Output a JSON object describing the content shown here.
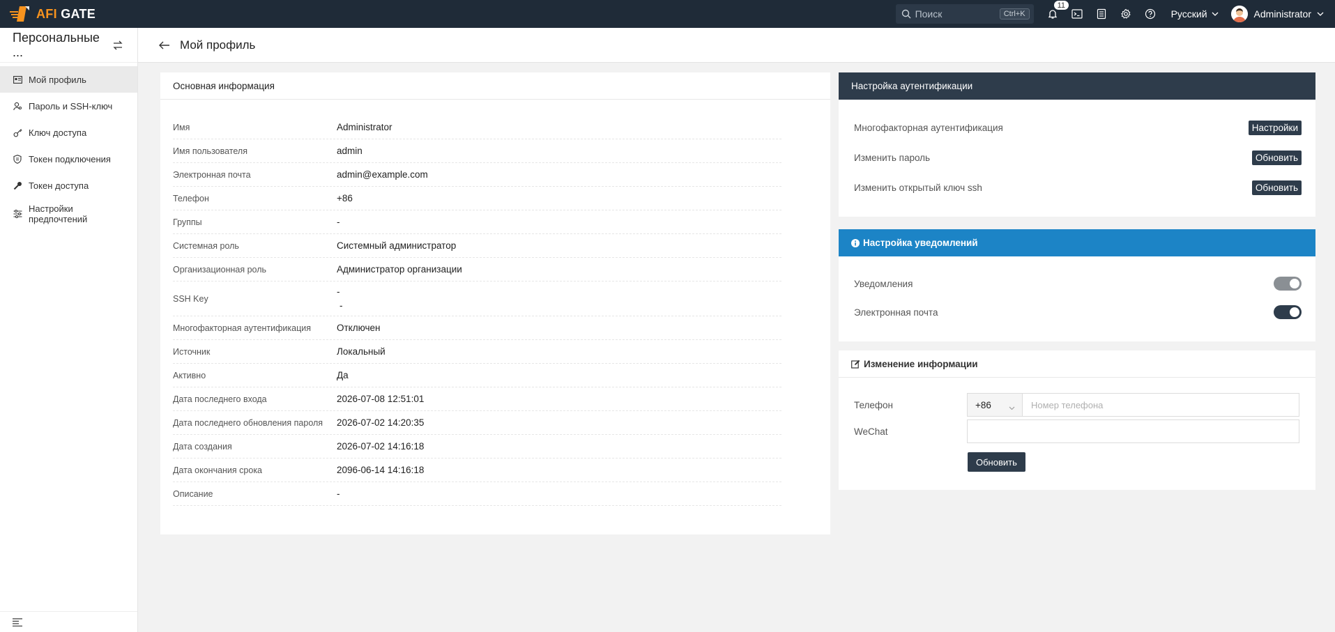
{
  "app": {
    "logo_prefix": "AFI",
    "logo_suffix": "GATE"
  },
  "topbar": {
    "search_placeholder": "Поиск",
    "search_shortcut": "Ctrl+K",
    "notifications_count": "11",
    "language": "Русский",
    "user_name": "Administrator"
  },
  "sidebar": {
    "title": "Персональные ...",
    "items": [
      {
        "label": "Мой профиль",
        "icon": "profile-card-icon",
        "active": true
      },
      {
        "label": "Пароль и SSH-ключ",
        "icon": "user-key-icon"
      },
      {
        "label": "Ключ доступа",
        "icon": "key-icon"
      },
      {
        "label": "Токен подключения",
        "icon": "shield-token-icon"
      },
      {
        "label": "Токен доступа",
        "icon": "wrench-key-icon"
      },
      {
        "label": "Настройки предпочтений",
        "icon": "sliders-icon"
      }
    ]
  },
  "page": {
    "title": "Мой профиль"
  },
  "basic_info": {
    "title": "Основная информация",
    "rows": [
      {
        "key": "Имя",
        "value": "Administrator"
      },
      {
        "key": "Имя пользователя",
        "value": "admin"
      },
      {
        "key": "Электронная почта",
        "value": "admin@example.com"
      },
      {
        "key": "Телефон",
        "value": "+86"
      },
      {
        "key": "Группы",
        "value": "-"
      },
      {
        "key": "Системная роль",
        "value": "Системный администратор"
      },
      {
        "key": "Организационная роль",
        "value": "Администратор организации"
      },
      {
        "key": "SSH Key",
        "value": "-",
        "value2": "-"
      },
      {
        "key": "Многофакторная аутентификация",
        "value": "Отключен"
      },
      {
        "key": "Источник",
        "value": "Локальный"
      },
      {
        "key": "Активно",
        "value": "Да"
      },
      {
        "key": "Дата последнего входа",
        "value": "2026-07-08 12:51:01"
      },
      {
        "key": "Дата последнего обновления пароля",
        "value": "2026-07-02 14:20:35"
      },
      {
        "key": "Дата создания",
        "value": "2026-07-02 14:16:18"
      },
      {
        "key": "Дата окончания срока",
        "value": "2096-06-14 14:16:18"
      },
      {
        "key": "Описание",
        "value": "-"
      }
    ]
  },
  "auth_settings": {
    "title": "Настройка аутентификации",
    "rows": [
      {
        "label": "Многофакторная аутентификация",
        "button": "Настройки"
      },
      {
        "label": "Изменить пароль",
        "button": "Обновить"
      },
      {
        "label": "Изменить открытый ключ ssh",
        "button": "Обновить"
      }
    ]
  },
  "notify_settings": {
    "title": "Настройка уведомлений",
    "rows": [
      {
        "label": "Уведомления",
        "enabled": true,
        "color": "#8a8f94"
      },
      {
        "label": "Электронная почта",
        "enabled": true,
        "color": "#2e3c4b"
      }
    ]
  },
  "edit_info": {
    "title": "Изменение информации",
    "phone_label": "Телефон",
    "phone_code": "+86",
    "phone_placeholder": "Номер телефона",
    "phone_value": "",
    "wechat_label": "WeChat",
    "wechat_value": "",
    "submit": "Обновить"
  },
  "colors": {
    "topbar": "#1f2b38",
    "accent_orange": "#f7931e",
    "dark_header": "#2e3c4b",
    "blue_header": "#1c84c6"
  }
}
